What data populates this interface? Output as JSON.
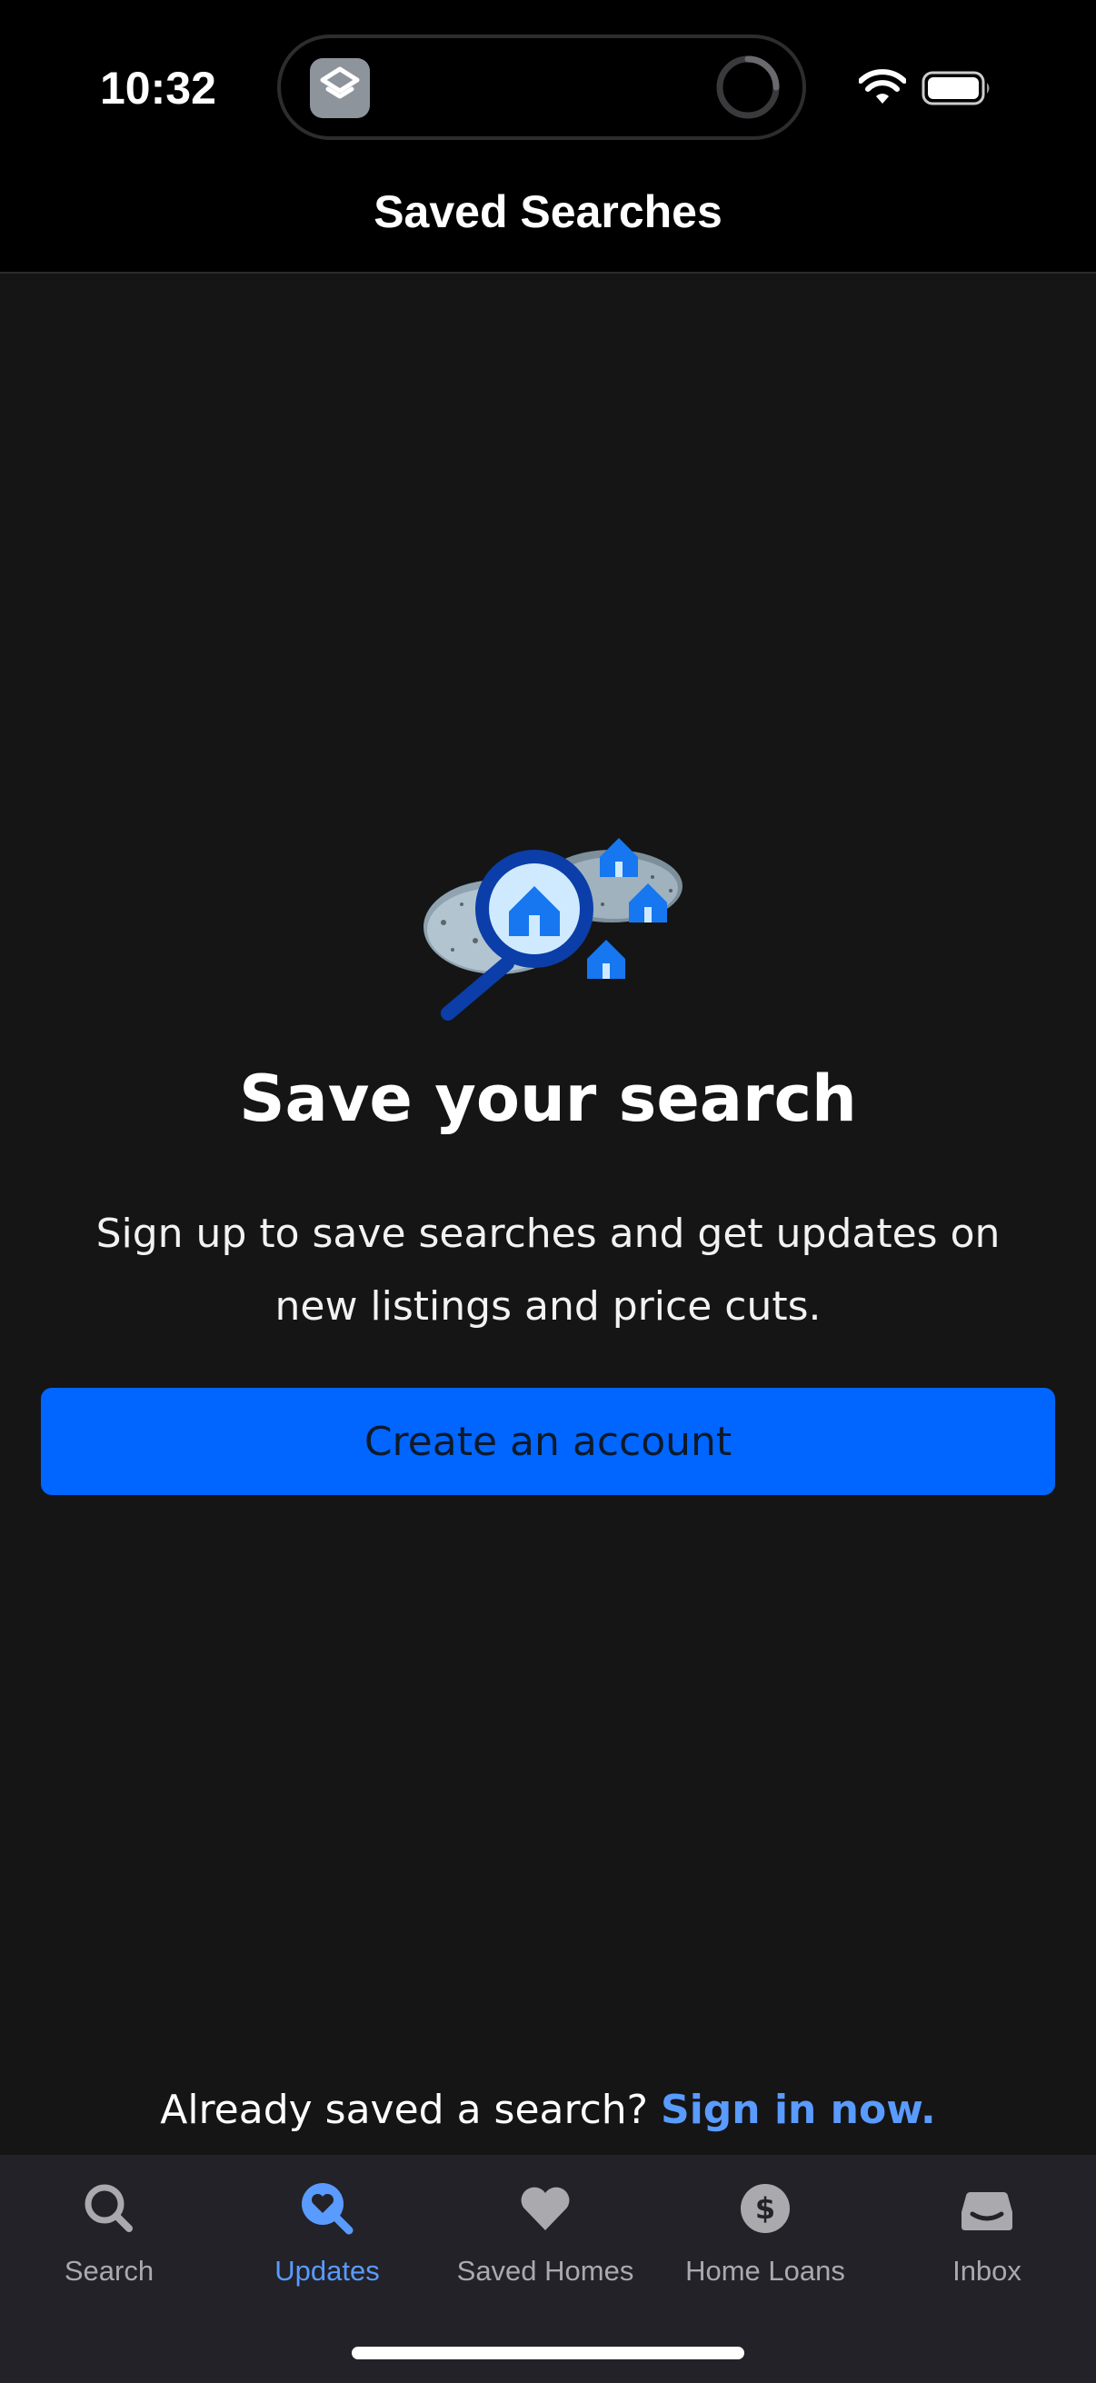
{
  "status_bar": {
    "time": "10:32"
  },
  "header": {
    "title": "Saved Searches"
  },
  "main": {
    "illustration_icon": "magnifier-over-houses-illustration",
    "headline": "Save your search",
    "body": "Sign up to save searches and get updates on new listings and price cuts.",
    "cta_label": "Create an account",
    "signin_prompt": "Already saved a search?",
    "signin_link": "Sign in now."
  },
  "tabs": [
    {
      "label": "Search",
      "icon": "search-icon",
      "active": false
    },
    {
      "label": "Updates",
      "icon": "heart-search-icon",
      "active": true
    },
    {
      "label": "Saved Homes",
      "icon": "heart-icon",
      "active": false
    },
    {
      "label": "Home Loans",
      "icon": "dollar-icon",
      "active": false
    },
    {
      "label": "Inbox",
      "icon": "inbox-icon",
      "active": false
    }
  ],
  "colors": {
    "background": "#151516",
    "accent": "#0066ff",
    "link": "#5a9bff",
    "tabbar": "#222228"
  }
}
